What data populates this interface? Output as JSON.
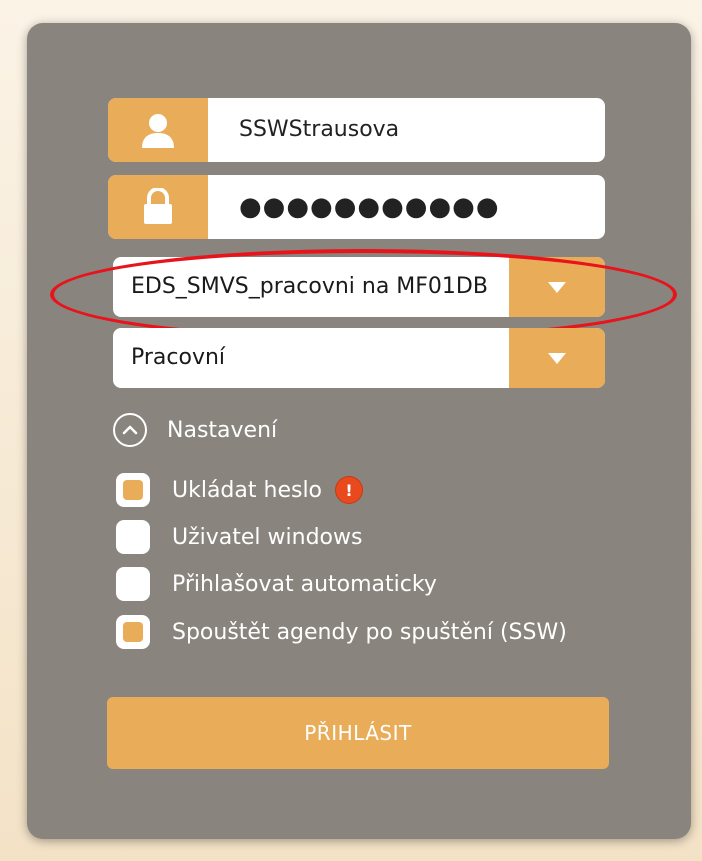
{
  "login_form": {
    "username": {
      "icon": "user-icon",
      "value": "SSWStrausova"
    },
    "password": {
      "icon": "lock-icon",
      "value": "●●●●●●●●●●●"
    },
    "database_select": {
      "value": "EDS_SMVS_pracovni na MF01DB",
      "icon": "dropdown-arrow-icon"
    },
    "environment_select": {
      "value": "Pracovní",
      "icon": "dropdown-arrow-icon"
    },
    "settings_toggle": {
      "label": "Nastavení",
      "icon": "chevron-up-icon"
    },
    "options": [
      {
        "label": "Ukládat heslo",
        "checked": true,
        "warning_icon": "exclamation-icon",
        "warning_glyph": "!"
      },
      {
        "label": "Uživatel windows",
        "checked": false
      },
      {
        "label": "Přihlašovat automaticky",
        "checked": false
      },
      {
        "label": "Spouštět agendy po spuštění (SSW)",
        "checked": true
      }
    ],
    "submit_label": "PŘIHLÁSIT"
  },
  "colors": {
    "panel": "#8a847e",
    "accent": "#e9ac58",
    "highlight_ring": "#e8141b",
    "warning": "#e84a1d"
  }
}
